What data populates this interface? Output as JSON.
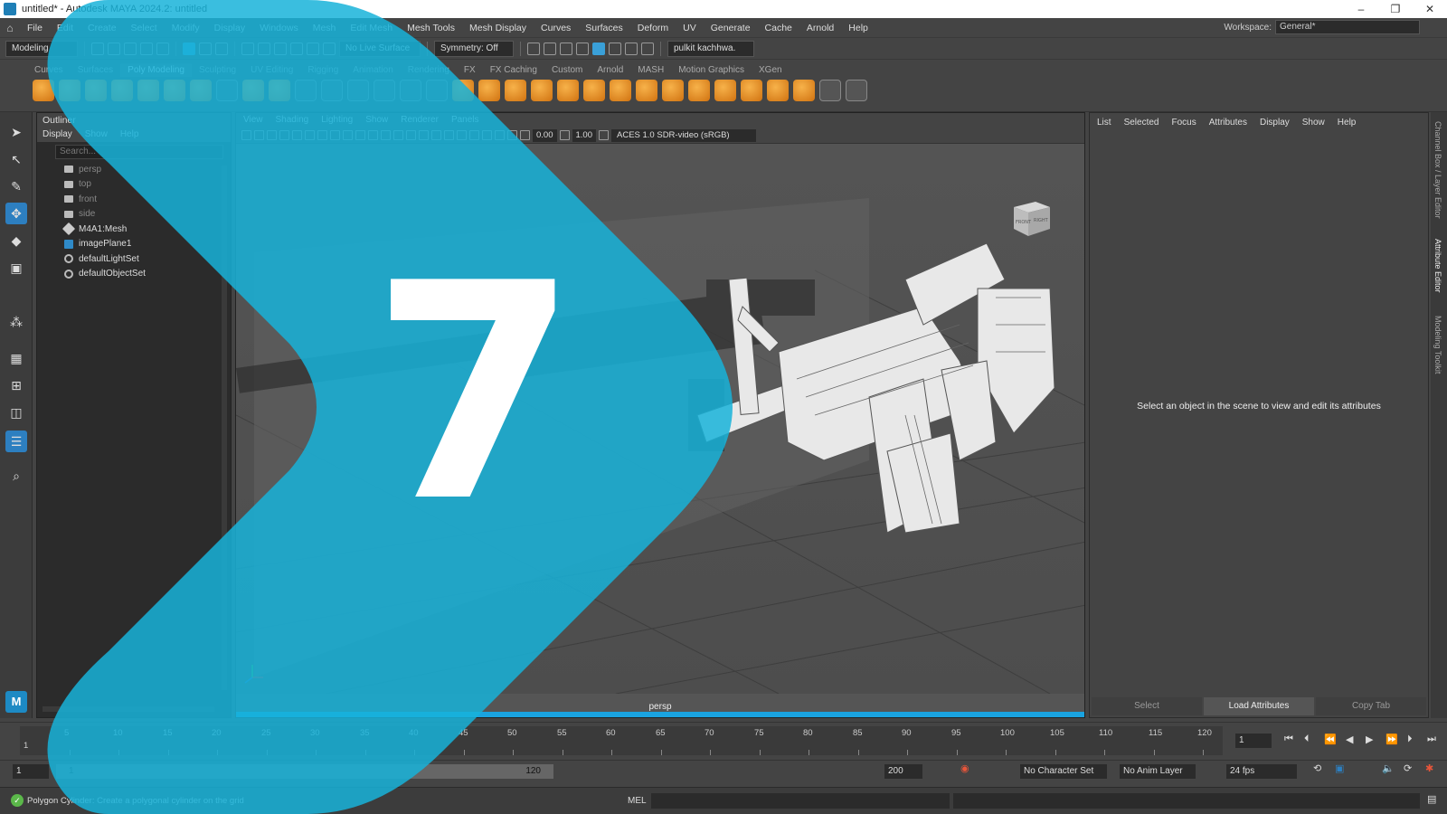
{
  "window": {
    "title": "untitled* - Autodesk MAYA 2024.2: untitled"
  },
  "menu": [
    "File",
    "Edit",
    "Create",
    "Select",
    "Modify",
    "Display",
    "Windows",
    "Mesh",
    "Edit Mesh",
    "Mesh Tools",
    "Mesh Display",
    "Curves",
    "Surfaces",
    "Deform",
    "UV",
    "Generate",
    "Cache",
    "Arnold",
    "Help"
  ],
  "workspace": {
    "label": "Workspace:",
    "value": "General*"
  },
  "toolbar": {
    "mode": "Modeling",
    "live_surface": "No Live Surface",
    "symmetry": "Symmetry: Off",
    "user": "pulkit kachhwa."
  },
  "shelf_tabs": [
    "Curves",
    "Surfaces",
    "Poly Modeling",
    "Sculpting",
    "UV Editing",
    "Rigging",
    "Animation",
    "Rendering",
    "FX",
    "FX Caching",
    "Custom",
    "Arnold",
    "MASH",
    "Motion Graphics",
    "XGen"
  ],
  "shelf_active": "Poly Modeling",
  "outliner": {
    "title": "Outliner",
    "menu": [
      "Display",
      "Show",
      "Help"
    ],
    "search_placeholder": "Search...",
    "items": [
      {
        "label": "persp",
        "type": "camera"
      },
      {
        "label": "top",
        "type": "camera"
      },
      {
        "label": "front",
        "type": "camera"
      },
      {
        "label": "side",
        "type": "camera"
      },
      {
        "label": "M4A1:Mesh",
        "type": "mesh"
      },
      {
        "label": "imagePlane1",
        "type": "plane"
      },
      {
        "label": "defaultLightSet",
        "type": "set"
      },
      {
        "label": "defaultObjectSet",
        "type": "set"
      }
    ]
  },
  "viewport": {
    "menu": [
      "View",
      "Shading",
      "Lighting",
      "Show",
      "Renderer",
      "Panels"
    ],
    "exposure": "0.00",
    "gamma": "1.00",
    "color_space": "ACES 1.0 SDR-video (sRGB)",
    "camera_label": "persp",
    "cube_front": "FRONT",
    "cube_right": "RIGHT"
  },
  "attribute_editor": {
    "menu": [
      "List",
      "Selected",
      "Focus",
      "Attributes",
      "Display",
      "Show",
      "Help"
    ],
    "message": "Select an object in the scene to view and edit its attributes",
    "buttons": [
      "Select",
      "Load Attributes",
      "Copy Tab"
    ],
    "active_button": "Load Attributes",
    "side_tabs": [
      "Channel Box / Layer Editor",
      "Attribute Editor",
      "Modeling Toolkit"
    ]
  },
  "timeline": {
    "ticks": [
      "5",
      "10",
      "15",
      "20",
      "25",
      "30",
      "35",
      "40",
      "45",
      "50",
      "55",
      "60",
      "65",
      "70",
      "75",
      "80",
      "85",
      "90",
      "95",
      "100",
      "105",
      "110",
      "115",
      "120"
    ],
    "start_tick": "1",
    "current_frame": "1"
  },
  "range": {
    "start": "1",
    "slider_start": "1",
    "slider_end": "120",
    "end": "200",
    "character_set": "No Character Set",
    "anim_layer": "No Anim Layer",
    "fps": "24 fps"
  },
  "status": {
    "hint": "Polygon Cylinder: Create a polygonal cylinder on the grid",
    "mel": "MEL"
  },
  "overlay": {
    "number": "7",
    "color": "#17b3d9"
  },
  "colors": {
    "accent": "#2d7fc0",
    "shelf_orange": "#d98a21"
  }
}
